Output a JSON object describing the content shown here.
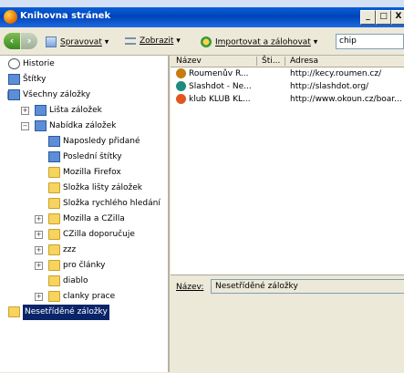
{
  "window": {
    "title": "Knihovna stránek",
    "min": "_",
    "max": "□",
    "close": "X"
  },
  "toolbar": {
    "back_glyph": "‹",
    "forward_glyph": "›",
    "organize": "Spravovat",
    "view": "Zobrazit",
    "import": "Importovat a zálohovat",
    "dropdown_glyph": "▾",
    "search_value": "chip"
  },
  "tree": [
    {
      "label": "Historie",
      "icon": "history-icon",
      "indent": 0,
      "expander": ""
    },
    {
      "label": "Štítky",
      "icon": "tags-icon",
      "indent": 0,
      "expander": ""
    },
    {
      "label": "Všechny záložky",
      "icon": "bookmarks-icon",
      "indent": 0,
      "expander": "−"
    },
    {
      "label": "Lišta záložek",
      "icon": "toolbar-icon",
      "indent": 1,
      "expander": "+"
    },
    {
      "label": "Nabídka záložek",
      "icon": "menu-icon",
      "indent": 1,
      "expander": "−"
    },
    {
      "label": "Naposledy přidané",
      "icon": "smart-folder-icon",
      "indent": 2,
      "expander": ""
    },
    {
      "label": "Poslední štítky",
      "icon": "smart-folder-icon",
      "indent": 2,
      "expander": ""
    },
    {
      "label": "Mozilla Firefox",
      "icon": "folder-icon",
      "indent": 2,
      "expander": ""
    },
    {
      "label": "Složka lišty záložek",
      "icon": "folder-icon",
      "indent": 2,
      "expander": ""
    },
    {
      "label": "Složka rychlého hledání",
      "icon": "folder-icon",
      "indent": 2,
      "expander": ""
    },
    {
      "label": "Mozilla a CZilla",
      "icon": "folder-icon",
      "indent": 2,
      "expander": "+"
    },
    {
      "label": "CZilla doporučuje",
      "icon": "folder-icon",
      "indent": 2,
      "expander": "+"
    },
    {
      "label": "zzz",
      "icon": "folder-icon",
      "indent": 2,
      "expander": "+"
    },
    {
      "label": "pro články",
      "icon": "folder-icon",
      "indent": 2,
      "expander": "+"
    },
    {
      "label": "diablo",
      "icon": "folder-icon",
      "indent": 2,
      "expander": ""
    },
    {
      "label": "clanky prace",
      "icon": "folder-icon",
      "indent": 2,
      "expander": "+"
    },
    {
      "label": "Nesetříděné záložky",
      "icon": "unsorted-icon",
      "indent": 0,
      "expander": "",
      "selected": true
    }
  ],
  "columns": {
    "name": "Název",
    "tags": "Šti...",
    "url": "Adresa"
  },
  "rows": [
    {
      "name": "Roumenův R...",
      "url": "http://kecy.roumen.cz/",
      "icon": "roumen-favicon",
      "color": "#c77b10"
    },
    {
      "name": "Slashdot - Ne...",
      "url": "http://slashdot.org/",
      "icon": "slashdot-favicon",
      "color": "#1e8c7d"
    },
    {
      "name": "klub KLUB KL...",
      "url": "http://www.okoun.cz/boar...",
      "icon": "okoun-favicon",
      "color": "#e2561e"
    }
  ],
  "details": {
    "name_label": "Název:",
    "name_value": "Nesetříděné záložky"
  }
}
